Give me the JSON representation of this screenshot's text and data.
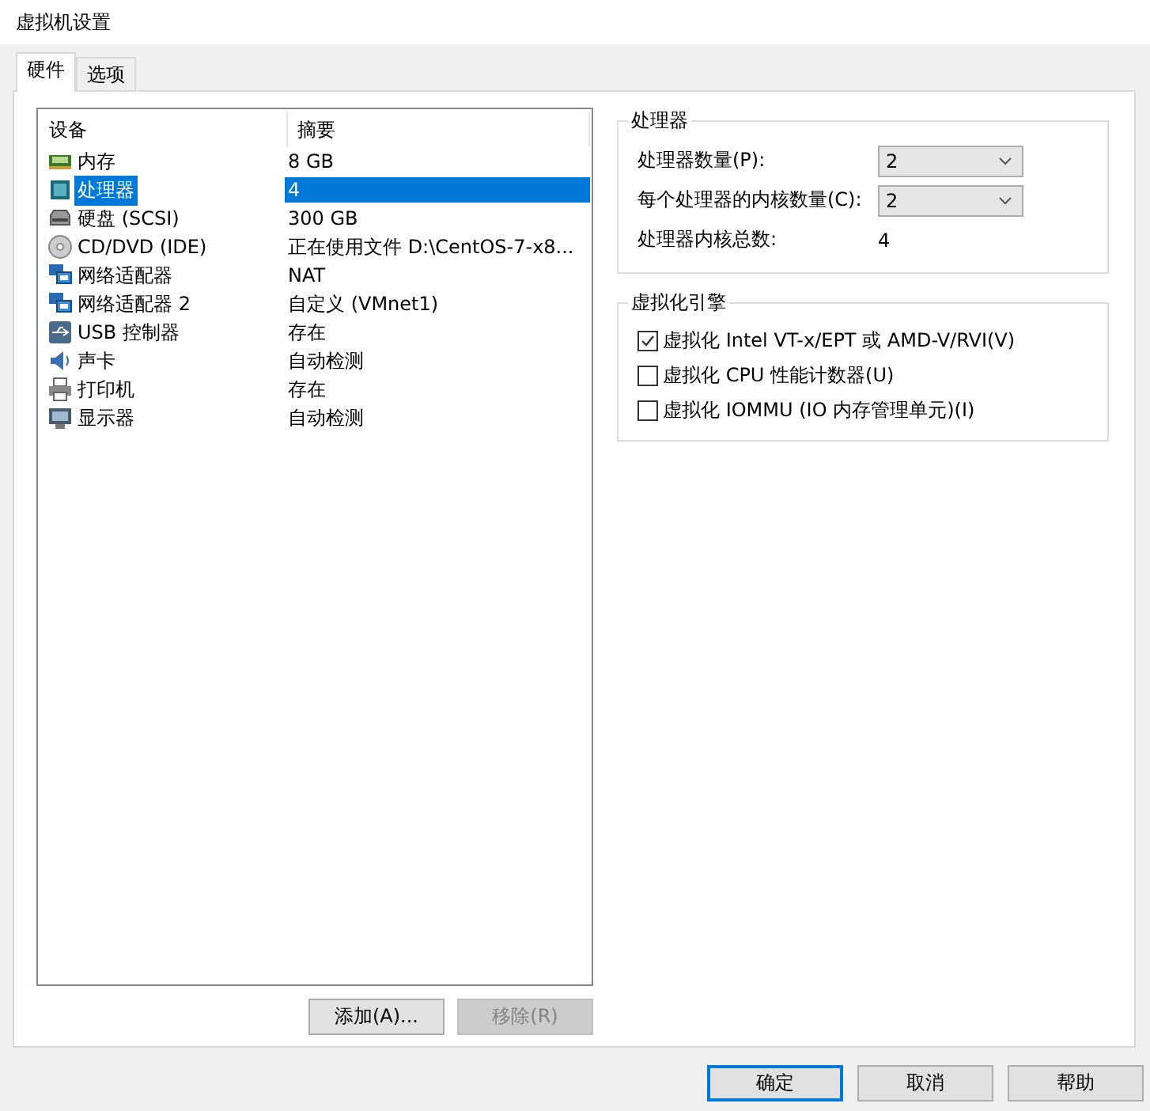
{
  "window": {
    "title": "虚拟机设置"
  },
  "tabs": [
    {
      "label": "硬件",
      "selected": true
    },
    {
      "label": "选项",
      "selected": false
    }
  ],
  "device_table": {
    "columns": [
      "设备",
      "摘要"
    ],
    "rows": [
      {
        "device": "内存",
        "summary": "8 GB",
        "selected": false
      },
      {
        "device": "处理器",
        "summary": "4",
        "selected": true
      },
      {
        "device": "硬盘 (SCSI)",
        "summary": "300 GB",
        "selected": false
      },
      {
        "device": "CD/DVD (IDE)",
        "summary": "正在使用文件 D:\\CentOS-7-x8...",
        "selected": false
      },
      {
        "device": "网络适配器",
        "summary": "NAT",
        "selected": false
      },
      {
        "device": "网络适配器 2",
        "summary": "自定义 (VMnet1)",
        "selected": false
      },
      {
        "device": "USB 控制器",
        "summary": "存在",
        "selected": false
      },
      {
        "device": "声卡",
        "summary": "自动检测",
        "selected": false
      },
      {
        "device": "打印机",
        "summary": "存在",
        "selected": false
      },
      {
        "device": "显示器",
        "summary": "自动检测",
        "selected": false
      }
    ]
  },
  "list_buttons": [
    {
      "label": "添加(A)...",
      "disabled": false
    },
    {
      "label": "移除(R)",
      "disabled": true
    }
  ],
  "processor_group": {
    "title": "处理器",
    "fields": [
      {
        "label": "处理器数量(P):",
        "value": "2"
      },
      {
        "label": "每个处理器的内核数量(C):",
        "value": "2"
      }
    ],
    "total_label": "处理器内核总数:",
    "total_value": "4"
  },
  "virtualization_group": {
    "title": "虚拟化引擎",
    "options": [
      {
        "label": "虚拟化 Intel VT-x/EPT 或 AMD-V/RVI(V)",
        "checked": true
      },
      {
        "label": "虚拟化 CPU 性能计数器(U)",
        "checked": false
      },
      {
        "label": "虚拟化 IOMMU (IO 内存管理单元)(I)",
        "checked": false
      }
    ]
  },
  "dialog_buttons": [
    {
      "label": "确定",
      "default": true
    },
    {
      "label": "取消",
      "default": false
    },
    {
      "label": "帮助",
      "default": false
    }
  ]
}
